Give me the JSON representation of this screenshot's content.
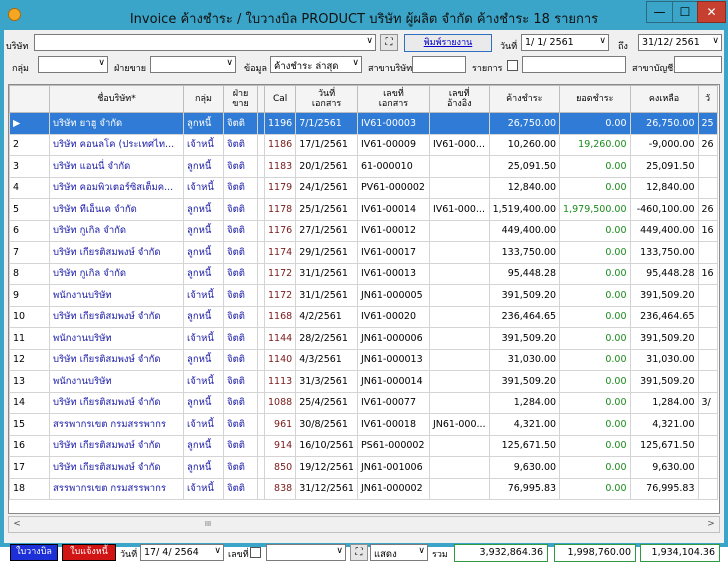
{
  "window": {
    "title": "Invoice ค้างชำระ / ใบวางบิล PRODUCT  บริษัท ผู้ผลิต จำกัด  ค้างชำระ 18 รายการ",
    "minimize": "—",
    "maximize": "☐",
    "close": "✕"
  },
  "filters": {
    "company_label": "บริษัท",
    "company_value": "",
    "print_button": "พิมพ์รายงาน",
    "date_label": "วันที่",
    "date_from": "1/ 1/ 2561",
    "to_label": "ถึง",
    "date_to": "31/12/ 2561",
    "group_label": "กลุ่ม",
    "group_value": "",
    "side_label": "ฝ่ายขาย",
    "side_value": "",
    "data_label": "ข้อมูล",
    "data_value": "ค้างชำระ ล่าสุด",
    "branch_label": "สาขาบริษัท",
    "branch_value": "",
    "items_label": "รายการ",
    "items_value": "",
    "acct_branch_label": "สาขาบัญชี",
    "acct_branch_value": ""
  },
  "table": {
    "headers": [
      "ชื่อบริษัท*",
      "กลุ่ม",
      "ฝ่าย\nขาย",
      "Cal",
      "วันที่\nเอกสาร",
      "เลขที่\nเอกสาร",
      "เลขที่\nอ้างอิง",
      "ค้างชำระ",
      "ยอดชำระ",
      "คงเหลือ",
      "วั"
    ],
    "rows": [
      {
        "n": "▶",
        "name": "บริษัท ยาฮู จำกัด",
        "grp": "ลูกหนี้",
        "side": "จิตติ",
        "cal": "1196",
        "date": "7/1/2561",
        "doc": "IV61-00003",
        "ref": "",
        "due": "26,750.00",
        "paid": "0.00",
        "bal": "26,750.00",
        "x": "25"
      },
      {
        "n": "2",
        "name": "บริษัท คอนลโค (ประเทศไท...",
        "grp": "เจ้าหนี้",
        "side": "จิตติ",
        "cal": "1186",
        "date": "17/1/2561",
        "doc": "IV61-00009",
        "ref": "IV61-000...",
        "due": "10,260.00",
        "paid": "19,260.00",
        "bal": "-9,000.00",
        "x": "26"
      },
      {
        "n": "3",
        "name": "บริษัท แอนนี่ จำกัด",
        "grp": "ลูกหนี้",
        "side": "จิตติ",
        "cal": "1183",
        "date": "20/1/2561",
        "doc": "61-000010",
        "ref": "",
        "due": "25,091.50",
        "paid": "0.00",
        "bal": "25,091.50",
        "x": ""
      },
      {
        "n": "4",
        "name": "บริษัท คอมพิวเตอร์ซิสเต็มค...",
        "grp": "เจ้าหนี้",
        "side": "จิตติ",
        "cal": "1179",
        "date": "24/1/2561",
        "doc": "PV61-000002",
        "ref": "",
        "due": "12,840.00",
        "paid": "0.00",
        "bal": "12,840.00",
        "x": ""
      },
      {
        "n": "5",
        "name": "บริษัท ทีเอ็นเค จำกัด",
        "grp": "ลูกหนี้",
        "side": "จิตติ",
        "cal": "1178",
        "date": "25/1/2561",
        "doc": "IV61-00014",
        "ref": "IV61-000...",
        "due": "1,519,400.00",
        "paid": "1,979,500.00",
        "bal": "-460,100.00",
        "x": "26"
      },
      {
        "n": "6",
        "name": "บริษัท กูเกิล จำกัด",
        "grp": "ลูกหนี้",
        "side": "จิตติ",
        "cal": "1176",
        "date": "27/1/2561",
        "doc": "IV61-00012",
        "ref": "",
        "due": "449,400.00",
        "paid": "0.00",
        "bal": "449,400.00",
        "x": "16"
      },
      {
        "n": "7",
        "name": "บริษัท เกียรติสมพงษ์ จำกัด",
        "grp": "ลูกหนี้",
        "side": "จิตติ",
        "cal": "1174",
        "date": "29/1/2561",
        "doc": "IV61-00017",
        "ref": "",
        "due": "133,750.00",
        "paid": "0.00",
        "bal": "133,750.00",
        "x": ""
      },
      {
        "n": "8",
        "name": "บริษัท กูเกิล จำกัด",
        "grp": "ลูกหนี้",
        "side": "จิตติ",
        "cal": "1172",
        "date": "31/1/2561",
        "doc": "IV61-00013",
        "ref": "",
        "due": "95,448.28",
        "paid": "0.00",
        "bal": "95,448.28",
        "x": "16"
      },
      {
        "n": "9",
        "name": "พนักงานบริษัท",
        "grp": "เจ้าหนี้",
        "side": "จิตติ",
        "cal": "1172",
        "date": "31/1/2561",
        "doc": "JN61-000005",
        "ref": "",
        "due": "391,509.20",
        "paid": "0.00",
        "bal": "391,509.20",
        "x": ""
      },
      {
        "n": "10",
        "name": "บริษัท เกียรติสมพงษ์ จำกัด",
        "grp": "ลูกหนี้",
        "side": "จิตติ",
        "cal": "1168",
        "date": "4/2/2561",
        "doc": "IV61-00020",
        "ref": "",
        "due": "236,464.65",
        "paid": "0.00",
        "bal": "236,464.65",
        "x": ""
      },
      {
        "n": "11",
        "name": "พนักงานบริษัท",
        "grp": "เจ้าหนี้",
        "side": "จิตติ",
        "cal": "1144",
        "date": "28/2/2561",
        "doc": "JN61-000006",
        "ref": "",
        "due": "391,509.20",
        "paid": "0.00",
        "bal": "391,509.20",
        "x": ""
      },
      {
        "n": "12",
        "name": "บริษัท เกียรติสมพงษ์ จำกัด",
        "grp": "ลูกหนี้",
        "side": "จิตติ",
        "cal": "1140",
        "date": "4/3/2561",
        "doc": "JN61-000013",
        "ref": "",
        "due": "31,030.00",
        "paid": "0.00",
        "bal": "31,030.00",
        "x": ""
      },
      {
        "n": "13",
        "name": "พนักงานบริษัท",
        "grp": "เจ้าหนี้",
        "side": "จิตติ",
        "cal": "1113",
        "date": "31/3/2561",
        "doc": "JN61-000014",
        "ref": "",
        "due": "391,509.20",
        "paid": "0.00",
        "bal": "391,509.20",
        "x": ""
      },
      {
        "n": "14",
        "name": "บริษัท เกียรติสมพงษ์ จำกัด",
        "grp": "ลูกหนี้",
        "side": "จิตติ",
        "cal": "1088",
        "date": "25/4/2561",
        "doc": "IV61-00077",
        "ref": "",
        "due": "1,284.00",
        "paid": "0.00",
        "bal": "1,284.00",
        "x": "3/"
      },
      {
        "n": "15",
        "name": "สรรพากรเขต กรมสรรพากร",
        "grp": "เจ้าหนี้",
        "side": "จิตติ",
        "cal": "961",
        "date": "30/8/2561",
        "doc": "IV61-00018",
        "ref": "JN61-000...",
        "due": "4,321.00",
        "paid": "0.00",
        "bal": "4,321.00",
        "x": ""
      },
      {
        "n": "16",
        "name": "บริษัท เกียรติสมพงษ์ จำกัด",
        "grp": "ลูกหนี้",
        "side": "จิตติ",
        "cal": "914",
        "date": "16/10/2561",
        "doc": "PS61-000002",
        "ref": "",
        "due": "125,671.50",
        "paid": "0.00",
        "bal": "125,671.50",
        "x": ""
      },
      {
        "n": "17",
        "name": "บริษัท เกียรติสมพงษ์ จำกัด",
        "grp": "ลูกหนี้",
        "side": "จิตติ",
        "cal": "850",
        "date": "19/12/2561",
        "doc": "JN61-001006",
        "ref": "",
        "due": "9,630.00",
        "paid": "0.00",
        "bal": "9,630.00",
        "x": ""
      },
      {
        "n": "18",
        "name": "สรรพากรเขต กรมสรรพากร",
        "grp": "เจ้าหนี้",
        "side": "จิตติ",
        "cal": "838",
        "date": "31/12/2561",
        "doc": "JN61-000002",
        "ref": "",
        "due": "76,995.83",
        "paid": "0.00",
        "bal": "76,995.83",
        "x": ""
      }
    ]
  },
  "bottom": {
    "bill_tag": "ใบวางบิล",
    "notice_tag": "ใบแจ้งหนี้",
    "date_label": "วันที่",
    "date_value": "17/ 4/ 2564",
    "docno_label": "เลขที่",
    "show_value": "แสดง",
    "total_label": "รวม",
    "total_due": "3,932,864.36",
    "total_paid": "1,998,760.00",
    "total_bal": "1,934,104.36"
  },
  "colors": {
    "selected_row": "#2f7bd6",
    "paid_green": "#1b8a1b",
    "titlebar": "#3aa5c8",
    "bill_tag": "#1d2fd6",
    "notice_tag": "#d11414"
  }
}
